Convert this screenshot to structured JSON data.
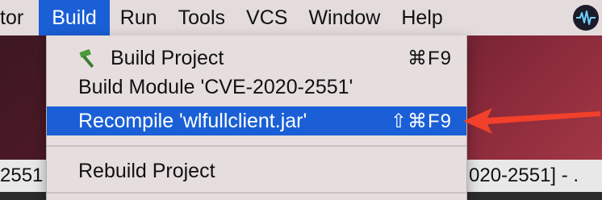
{
  "menubar": {
    "items": [
      {
        "label": "tor"
      },
      {
        "label": "Build"
      },
      {
        "label": "Run"
      },
      {
        "label": "Tools"
      },
      {
        "label": "VCS"
      },
      {
        "label": "Window"
      },
      {
        "label": "Help"
      }
    ]
  },
  "build_menu": {
    "items": [
      {
        "label": "Build Project",
        "shortcut": "⌘F9",
        "icon": "hammer-icon"
      },
      {
        "label": "Build Module 'CVE-2020-2551'",
        "shortcut": ""
      },
      {
        "label": "Recompile 'wlfullclient.jar'",
        "shortcut": "⇧⌘F9",
        "highlighted": true
      },
      {
        "label": "Rebuild Project",
        "shortcut": ""
      }
    ]
  },
  "background": {
    "left_text": "2551",
    "right_text": "020-2551] - ."
  },
  "colors": {
    "highlight": "#1a5fd6",
    "arrow": "#f2402a",
    "hammer": "#4a9a3a"
  }
}
